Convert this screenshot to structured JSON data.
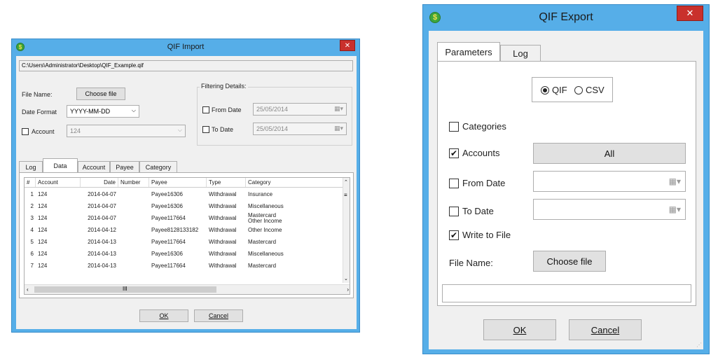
{
  "import_dialog": {
    "title": "QIF Import",
    "path": "C:\\Users\\Administrator\\Desktop\\QIF_Example.qif",
    "file_name_label": "File Name:",
    "choose_file": "Choose file",
    "date_format_label": "Date Format",
    "date_format_value": "YYYY-MM-DD",
    "account_label": "Account",
    "account_value": "124",
    "filtering_label": "Filtering Details:",
    "from_date_label": "From Date",
    "from_date_value": "25/05/2014",
    "to_date_label": "To Date",
    "to_date_value": "25/05/2014",
    "tabs": [
      "Log",
      "Data",
      "Account",
      "Payee",
      "Category"
    ],
    "active_tab": "Data",
    "columns": [
      "#",
      "Account",
      "Date",
      "Number",
      "Payee",
      "Type",
      "Category"
    ],
    "rows": [
      {
        "n": "1",
        "account": "124",
        "date": "2014-04-07",
        "number": "",
        "payee": "Payee16306",
        "type": "Withdrawal",
        "category": "Insurance"
      },
      {
        "n": "2",
        "account": "124",
        "date": "2014-04-07",
        "number": "",
        "payee": "Payee16306",
        "type": "Withdrawal",
        "category": "Miscellaneous"
      },
      {
        "n": "3",
        "account": "124",
        "date": "2014-04-07",
        "number": "",
        "payee": "Payee117664",
        "type": "Withdrawal",
        "category": "Mastercard",
        "category2": "Other Income"
      },
      {
        "n": "4",
        "account": "124",
        "date": "2014-04-12",
        "number": "",
        "payee": "Payee8128133182",
        "type": "Withdrawal",
        "category": "Other Income"
      },
      {
        "n": "5",
        "account": "124",
        "date": "2014-04-13",
        "number": "",
        "payee": "Payee117664",
        "type": "Withdrawal",
        "category": "Mastercard"
      },
      {
        "n": "6",
        "account": "124",
        "date": "2014-04-13",
        "number": "",
        "payee": "Payee16306",
        "type": "Withdrawal",
        "category": "Miscellaneous"
      },
      {
        "n": "7",
        "account": "124",
        "date": "2014-04-13",
        "number": "",
        "payee": "Payee117664",
        "type": "Withdrawal",
        "category": "Mastercard"
      }
    ],
    "ok": "OK",
    "cancel": "Cancel"
  },
  "export_dialog": {
    "title": "QIF Export",
    "tabs": [
      "Parameters",
      "Log"
    ],
    "active_tab": "Parameters",
    "format_options": [
      "QIF",
      "CSV"
    ],
    "selected_format": "QIF",
    "categories_label": "Categories",
    "categories_checked": false,
    "accounts_label": "Accounts",
    "accounts_checked": true,
    "all_button": "All",
    "from_date_label": "From Date",
    "to_date_label": "To Date",
    "write_to_file_label": "Write to File",
    "write_to_file_checked": true,
    "file_name_label": "File Name:",
    "choose_file": "Choose file",
    "ok": "OK",
    "cancel": "Cancel"
  },
  "colors": {
    "frame": "#56aee8",
    "close": "#c9302c",
    "client": "#f0f0f0"
  }
}
